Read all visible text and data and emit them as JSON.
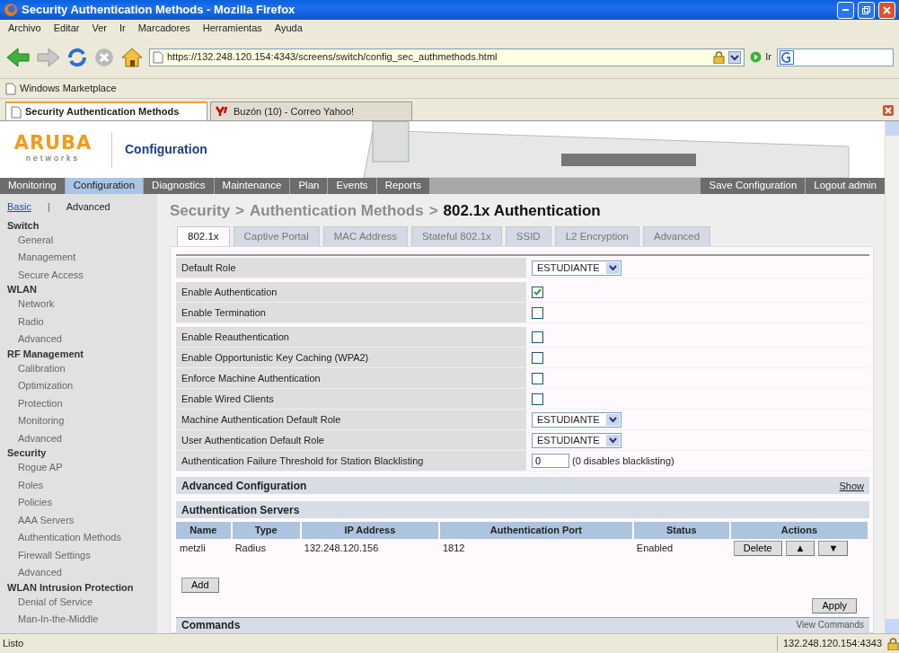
{
  "window": {
    "title": "Security Authentication Methods - Mozilla Firefox"
  },
  "menu": [
    "Archivo",
    "Editar",
    "Ver",
    "Ir",
    "Marcadores",
    "Herramientas",
    "Ayuda"
  ],
  "address_bar": {
    "url": "https://132.248.120.154:4343/screens/switch/config_sec_authmethods.html",
    "go_label": "Ir"
  },
  "bookmarks": [
    "Windows Marketplace"
  ],
  "browser_tabs": [
    {
      "label": "Security Authentication Methods",
      "selected": true
    },
    {
      "label": "Buzón (10) - Correo Yahoo!",
      "selected": false
    }
  ],
  "app_header": {
    "logo_text": "ARUBA",
    "logo_subtext": "networks",
    "title": "Configuration"
  },
  "main_nav": [
    {
      "label": "Monitoring",
      "selected": false
    },
    {
      "label": "Configuration",
      "selected": true
    },
    {
      "label": "Diagnostics",
      "selected": false
    },
    {
      "label": "Maintenance",
      "selected": false
    },
    {
      "label": "Plan",
      "selected": false
    },
    {
      "label": "Events",
      "selected": false
    },
    {
      "label": "Reports",
      "selected": false
    }
  ],
  "nav_right": [
    "Save Configuration",
    "Logout admin"
  ],
  "sidebar": {
    "modes": [
      {
        "label": "Basic",
        "selected": false
      },
      {
        "label": "Advanced",
        "selected": true
      }
    ],
    "mode_separator": "|",
    "sections": [
      {
        "title": "Switch",
        "items": [
          "General",
          "Management",
          "Secure Access"
        ]
      },
      {
        "title": "WLAN",
        "items": [
          "Network",
          "Radio",
          "Advanced"
        ]
      },
      {
        "title": "RF Management",
        "items": [
          "Calibration",
          "Optimization",
          "Protection",
          "Monitoring",
          "Advanced"
        ]
      },
      {
        "title": "Security",
        "items": [
          "Rogue AP",
          "Roles",
          "Policies",
          "AAA Servers",
          "Authentication Methods",
          "Firewall Settings",
          "Advanced"
        ]
      },
      {
        "title": "WLAN Intrusion Protection",
        "items": [
          "Denial of Service",
          "Man-In-the-Middle"
        ]
      }
    ]
  },
  "breadcrumb": [
    {
      "kind": "crumb",
      "label": "Security"
    },
    {
      "kind": "separator",
      "label": ">"
    },
    {
      "kind": "crumb",
      "label": "Authentication Methods"
    },
    {
      "kind": "separator",
      "label": ">"
    },
    {
      "kind": "current",
      "label": "802.1x Authentication"
    }
  ],
  "page_tabs": [
    {
      "label": "802.1x",
      "selected": true
    },
    {
      "label": "Captive Portal",
      "selected": false
    },
    {
      "label": "MAC Address",
      "selected": false
    },
    {
      "label": "Stateful 802.1x",
      "selected": false
    },
    {
      "label": "SSID",
      "selected": false
    },
    {
      "label": "L2 Encryption",
      "selected": false
    },
    {
      "label": "Advanced",
      "selected": false
    }
  ],
  "setting_groups": [
    [
      {
        "kind": "select",
        "label": "Default Role",
        "value": "ESTUDIANTE"
      }
    ],
    [
      {
        "kind": "checkbox",
        "label": "Enable Authentication",
        "checked": true
      },
      {
        "kind": "checkbox",
        "label": "Enable Termination",
        "checked": false
      }
    ],
    [
      {
        "kind": "checkbox",
        "label": "Enable Reauthentication",
        "checked": false
      },
      {
        "kind": "checkbox",
        "label": "Enable Opportunistic Key Caching (WPA2)",
        "checked": false
      },
      {
        "kind": "checkbox",
        "label": "Enforce Machine Authentication",
        "checked": false
      },
      {
        "kind": "checkbox",
        "label": "Enable Wired Clients",
        "checked": false
      },
      {
        "kind": "select",
        "label": "Machine Authentication Default Role",
        "value": "ESTUDIANTE"
      },
      {
        "kind": "select",
        "label": "User Authentication Default Role",
        "value": "ESTUDIANTE"
      },
      {
        "kind": "number",
        "label": "Authentication Failure Threshold for Station Blacklisting",
        "value": "0",
        "hint": "(0 disables blacklisting)"
      }
    ]
  ],
  "advanced_configuration": {
    "title": "Advanced Configuration",
    "toggle": "Show"
  },
  "auth_servers": {
    "title": "Authentication Servers",
    "columns": [
      "Name",
      "Type",
      "IP Address",
      "Authentication Port",
      "Status",
      "Actions"
    ],
    "rows": [
      {
        "cells": [
          "metzli",
          "Radius",
          "132.248.120.156",
          "1812",
          "Enabled"
        ],
        "actions": [
          "Delete",
          "▲",
          "▼"
        ]
      }
    ],
    "add_button": "Add"
  },
  "apply_button": "Apply",
  "commands": {
    "title": "Commands",
    "link": "View Commands"
  },
  "status_bar": {
    "text": "Listo",
    "host": "132.248.120.154:4343"
  }
}
